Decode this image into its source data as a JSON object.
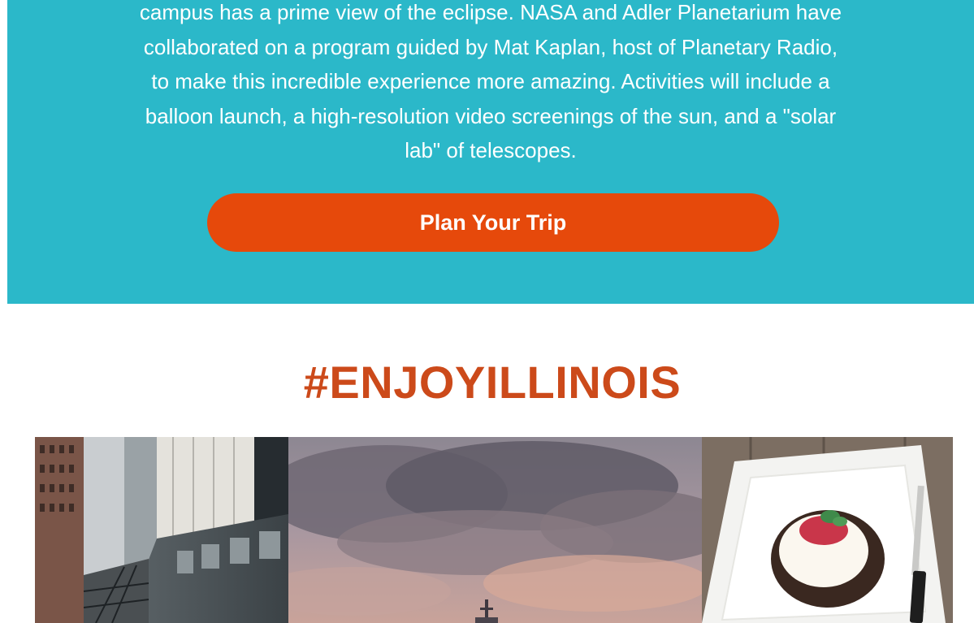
{
  "eclipse_section": {
    "lines": [
      "campus has a prime view of the eclipse. NASA and Adler Planetarium have",
      "collaborated on a program guided by Mat Kaplan, host of Planetary Radio,",
      "to make this incredible experience more amazing. Activities will include a",
      "balloon launch, a high-resolution video screenings of the sun, and a \"solar",
      "lab\" of telescopes."
    ],
    "cta_label": "Plan Your Trip",
    "background_color": "#2bb8c9",
    "button_color": "#e6490b"
  },
  "social": {
    "hashtag": "#ENJOYILLINOIS",
    "hashtag_color": "#cc4a1a",
    "photos": [
      {
        "subject": "elevated-train-photo"
      },
      {
        "subject": "stormy-sky-photo"
      },
      {
        "subject": "dessert-plate-photo"
      }
    ]
  }
}
